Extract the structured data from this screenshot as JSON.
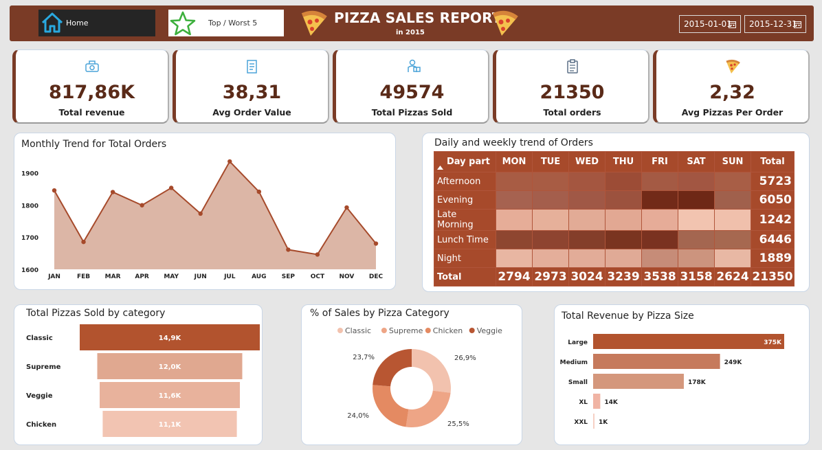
{
  "header": {
    "home_label": "Home",
    "top_worst_label": "Top / Worst 5",
    "title": "PIZZA SALES REPORT",
    "subtitle": "in 2015",
    "date_from": "2015-01-01",
    "date_to": "2015-12-31"
  },
  "kpis": [
    {
      "value": "817,86K",
      "label": "Total revenue",
      "icon": "money-icon"
    },
    {
      "value": "38,31",
      "label": "Avg Order Value",
      "icon": "receipt-icon"
    },
    {
      "value": "49574",
      "label": "Total Pizzas Sold",
      "icon": "delivery-icon"
    },
    {
      "value": "21350",
      "label": "Total orders",
      "icon": "clipboard-icon"
    },
    {
      "value": "2,32",
      "label": "Avg Pizzas Per Order",
      "icon": "pizza-slice-icon"
    }
  ],
  "colors": {
    "brown": "#7a3b26",
    "accent": "#a74a2b",
    "area": "#dcb6a6",
    "line": "#a64a2b"
  },
  "chart_data": [
    {
      "type": "area",
      "title": "Monthly Trend for Total Orders",
      "categories": [
        "JAN",
        "FEB",
        "MAR",
        "APR",
        "MAY",
        "JUN",
        "JUL",
        "AUG",
        "SEP",
        "OCT",
        "NOV",
        "DEC"
      ],
      "values": [
        1845,
        1685,
        1840,
        1799,
        1853,
        1773,
        1935,
        1841,
        1661,
        1646,
        1792,
        1680
      ],
      "ylim": [
        1600,
        1950
      ],
      "yticks": [
        1600,
        1700,
        1800,
        1900
      ]
    },
    {
      "type": "heatmap",
      "title": "Daily and weekly trend of Orders",
      "row_header": "Day part",
      "columns": [
        "MON",
        "TUE",
        "WED",
        "THU",
        "FRI",
        "SAT",
        "SUN"
      ],
      "total_header": "Total",
      "rows": [
        {
          "name": "Afternoon",
          "total": "5723",
          "shades": [
            "#a85c44",
            "#a85c44",
            "#a45640",
            "#9c4c36",
            "#a45a44",
            "#a25642",
            "#a85e46"
          ]
        },
        {
          "name": "Evening",
          "total": "6050",
          "shades": [
            "#a66250",
            "#a45e4c",
            "#a05846",
            "#9c523e",
            "#722a18",
            "#6e2816",
            "#a0604c"
          ]
        },
        {
          "name": "Late Morning",
          "total": "1242",
          "shades": [
            "#e6ad98",
            "#e6b09a",
            "#e2ab96",
            "#e2a893",
            "#e6ac98",
            "#f2c4b0",
            "#f0c0ac"
          ]
        },
        {
          "name": "Lunch Time",
          "total": "6446",
          "shades": [
            "#8e4630",
            "#8e4430",
            "#843e2a",
            "#7a3420",
            "#7a3220",
            "#a46650",
            "#a66850"
          ]
        },
        {
          "name": "Night",
          "total": "1889",
          "shades": [
            "#e8b6a2",
            "#e4ae9a",
            "#e2ac98",
            "#e0aa96",
            "#c68c78",
            "#cc947e",
            "#e8b8a4"
          ]
        }
      ],
      "totals_label": "Total",
      "column_totals": [
        "2794",
        "2973",
        "3024",
        "3239",
        "3538",
        "3158",
        "2624"
      ],
      "grand_total": "21350"
    },
    {
      "type": "bar",
      "title": "Total Pizzas Sold by category",
      "categories": [
        "Classic",
        "Supreme",
        "Veggie",
        "Chicken"
      ],
      "values": [
        14.9,
        12.0,
        11.6,
        11.1
      ],
      "labels": [
        "14,9K",
        "12,0K",
        "11,6K",
        "11,1K"
      ],
      "colors": [
        "#b2532e",
        "#e0a890",
        "#e8b29c",
        "#f2c4b2"
      ]
    },
    {
      "type": "pie",
      "title": "% of Sales by Pizza Category",
      "categories": [
        "Classic",
        "Supreme",
        "Chicken",
        "Veggie"
      ],
      "values": [
        26.9,
        25.5,
        24.0,
        23.7
      ],
      "labels": [
        "26,9%",
        "25,5%",
        "24,0%",
        "23,7%"
      ],
      "colors": [
        "#f2c2ae",
        "#eea586",
        "#e48a62",
        "#b85632"
      ]
    },
    {
      "type": "bar",
      "title": "Total Revenue by Pizza Size",
      "categories": [
        "Large",
        "Medium",
        "Small",
        "XL",
        "XXL"
      ],
      "values": [
        375,
        249,
        178,
        14,
        1
      ],
      "labels": [
        "375K",
        "249K",
        "178K",
        "14K",
        "1K"
      ],
      "colors": [
        "#b2532e",
        "#c67a5c",
        "#d4977c",
        "#f0b4a4",
        "#f6d0c4"
      ]
    }
  ]
}
